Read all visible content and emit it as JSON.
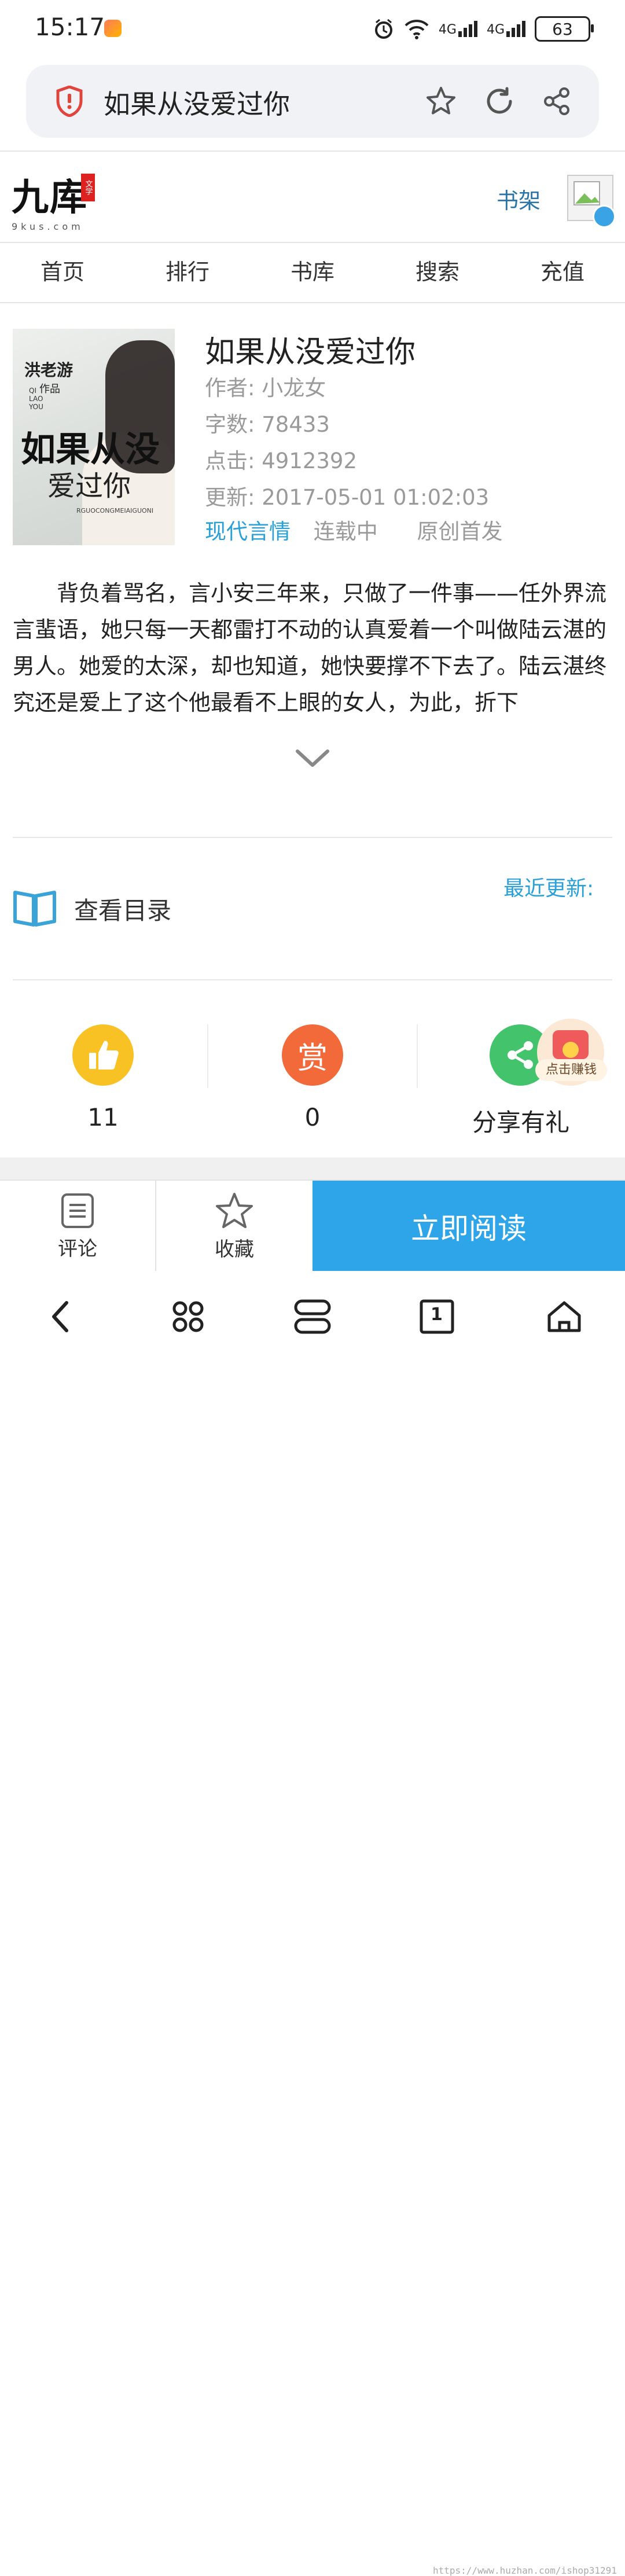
{
  "status_bar": {
    "time": "15:17",
    "signal1": "4G",
    "signal2": "4G",
    "battery": "63"
  },
  "address_bar": {
    "title": "如果从没爱过你"
  },
  "site": {
    "logo_text": "九库",
    "logo_sub": "9kus.com",
    "logo_seal": "文学",
    "shelf_link": "书架"
  },
  "nav": [
    "首页",
    "排行",
    "书库",
    "搜索",
    "充值"
  ],
  "book": {
    "cover": {
      "author": "洪老游",
      "author_suffix": "作品",
      "pinyin": "QI\nLAO\nYOU",
      "title_line1": "如果从没",
      "title_line2": "爱过你",
      "title_en": "RGUOCONGMEIAIGUONI"
    },
    "title": "如果从没爱过你",
    "author_label": "作者:",
    "author": "小龙女",
    "words_label": "字数:",
    "words": "78433",
    "clicks_label": "点击:",
    "clicks": "4912392",
    "updated_label": "更新:",
    "updated": "2017-05-01 01:02:03",
    "category": "现代言情",
    "status": "连载中",
    "origin": "原创首发",
    "description": "背负着骂名，言小安三年来，只做了一件事——任外界流言蜚语，她只每一天都雷打不动的认真爱着一个叫做陆云湛的男人。她爱的太深，却也知道，她快要撑不下去了。陆云湛终究还是爱上了这个他最看不上眼的女人，为此，折下"
  },
  "catalog": {
    "label": "查看目录",
    "recent_label": "最近更新:"
  },
  "actions": {
    "like": {
      "icon": "thumbs-up-icon",
      "count": "11",
      "color": "#f8c224"
    },
    "reward": {
      "icon_text": "赏",
      "count": "0",
      "color": "#f26a3a"
    },
    "share": {
      "icon": "share-icon",
      "label": "分享有礼",
      "color": "#43c36b"
    },
    "earn_label": "点击赚钱"
  },
  "bottom_bar": {
    "comment": "评论",
    "favorite": "收藏",
    "read_now": "立即阅读"
  },
  "system_nav": {
    "tab_count": "1"
  },
  "watermark": "https://www.huzhan.com/ishop31291",
  "colors": {
    "accent": "#2ea5e8",
    "link": "#2aa0d8"
  }
}
